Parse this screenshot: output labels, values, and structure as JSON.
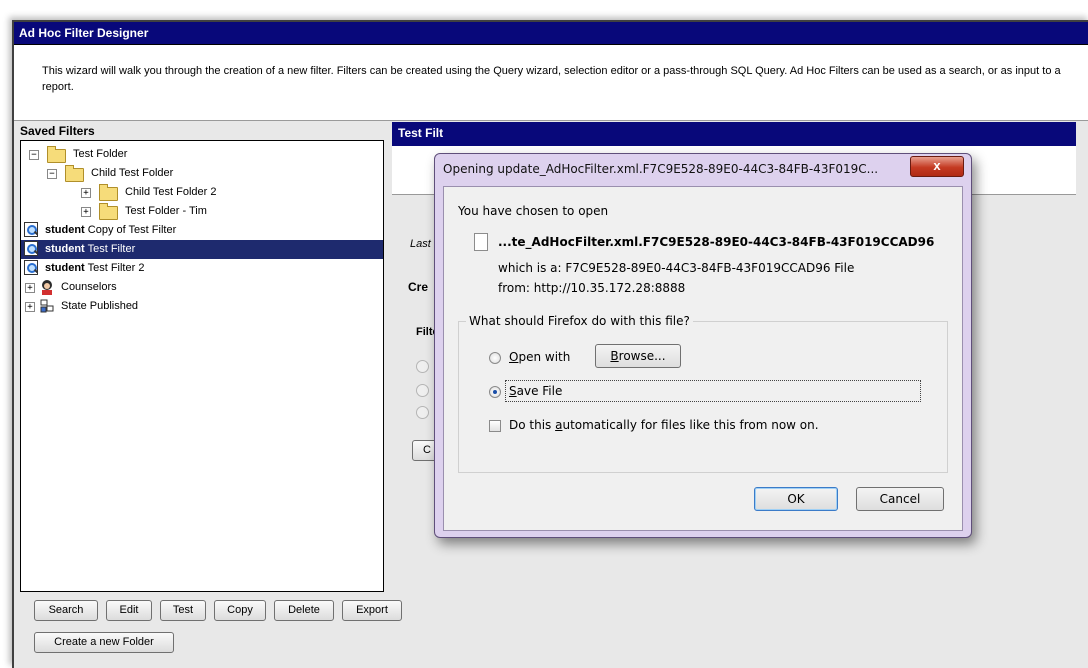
{
  "app": {
    "title": "Ad Hoc Filter Designer",
    "description": "This wizard will walk you through the creation of a new filter. Filters can be created using the Query wizard, selection editor or a pass-through SQL Query. Ad Hoc Filters can be used as a search, or as input to a report."
  },
  "saved_filters": {
    "title": "Saved Filters",
    "tree": [
      {
        "label": "Test Folder",
        "type": "folder",
        "level": 0,
        "expander": "−"
      },
      {
        "label": "Child Test Folder",
        "type": "folder",
        "level": 1,
        "expander": "−"
      },
      {
        "label": "Child Test Folder 2",
        "type": "folder",
        "level": 2,
        "expander": "+"
      },
      {
        "label": "Test Folder - Tim",
        "type": "folder",
        "level": 2,
        "expander": "+"
      },
      {
        "prefix": "student",
        "label": " Copy of Test Filter",
        "type": "filter"
      },
      {
        "prefix": "student",
        "label": " Test Filter",
        "type": "filter",
        "selected": true
      },
      {
        "prefix": "student",
        "label": " Test Filter 2",
        "type": "filter"
      },
      {
        "label": "Counselors",
        "type": "counselors",
        "expander": "+"
      },
      {
        "label": "State Published",
        "type": "state",
        "expander": "+"
      }
    ],
    "buttons": [
      "Search",
      "Edit",
      "Test",
      "Copy",
      "Delete",
      "Export"
    ],
    "new_folder_label": "Create a new Folder"
  },
  "right_panel": {
    "title_partial": "Test Filt",
    "last_partial": "Last",
    "create_partial": "Cre",
    "filter_partial": "Filte",
    "button_partial": "C"
  },
  "dialog": {
    "title": "Opening update_AdHocFilter.xml.F7C9E528-89E0-44C3-84FB-43F019C...",
    "close_glyph": "x",
    "chosen_text": "You have chosen to open",
    "file_name": "...te_AdHocFilter.xml.F7C9E528-89E0-44C3-84FB-43F019CCAD96",
    "which_is": "which is a:  F7C9E528-89E0-44C3-84FB-43F019CCAD96 File",
    "from": "from:  http://10.35.172.28:8888",
    "question": "What should Firefox do with this file?",
    "open_with_prefix": "",
    "open_with_key": "O",
    "open_with_rest": "pen with",
    "browse_key": "B",
    "browse_rest": "rowse...",
    "save_key": "S",
    "save_rest": "ave File",
    "auto_pre": "Do this ",
    "auto_key": "a",
    "auto_rest": "utomatically for files like this from now on.",
    "ok_label": "OK",
    "cancel_label": "Cancel",
    "selected_option": "save_file",
    "auto_checked": false
  },
  "colors": {
    "title_bar": "#08087a",
    "selection": "#1e2a6e",
    "dialog_frame": "#ddd1ee",
    "close_button": "#c43a22"
  }
}
